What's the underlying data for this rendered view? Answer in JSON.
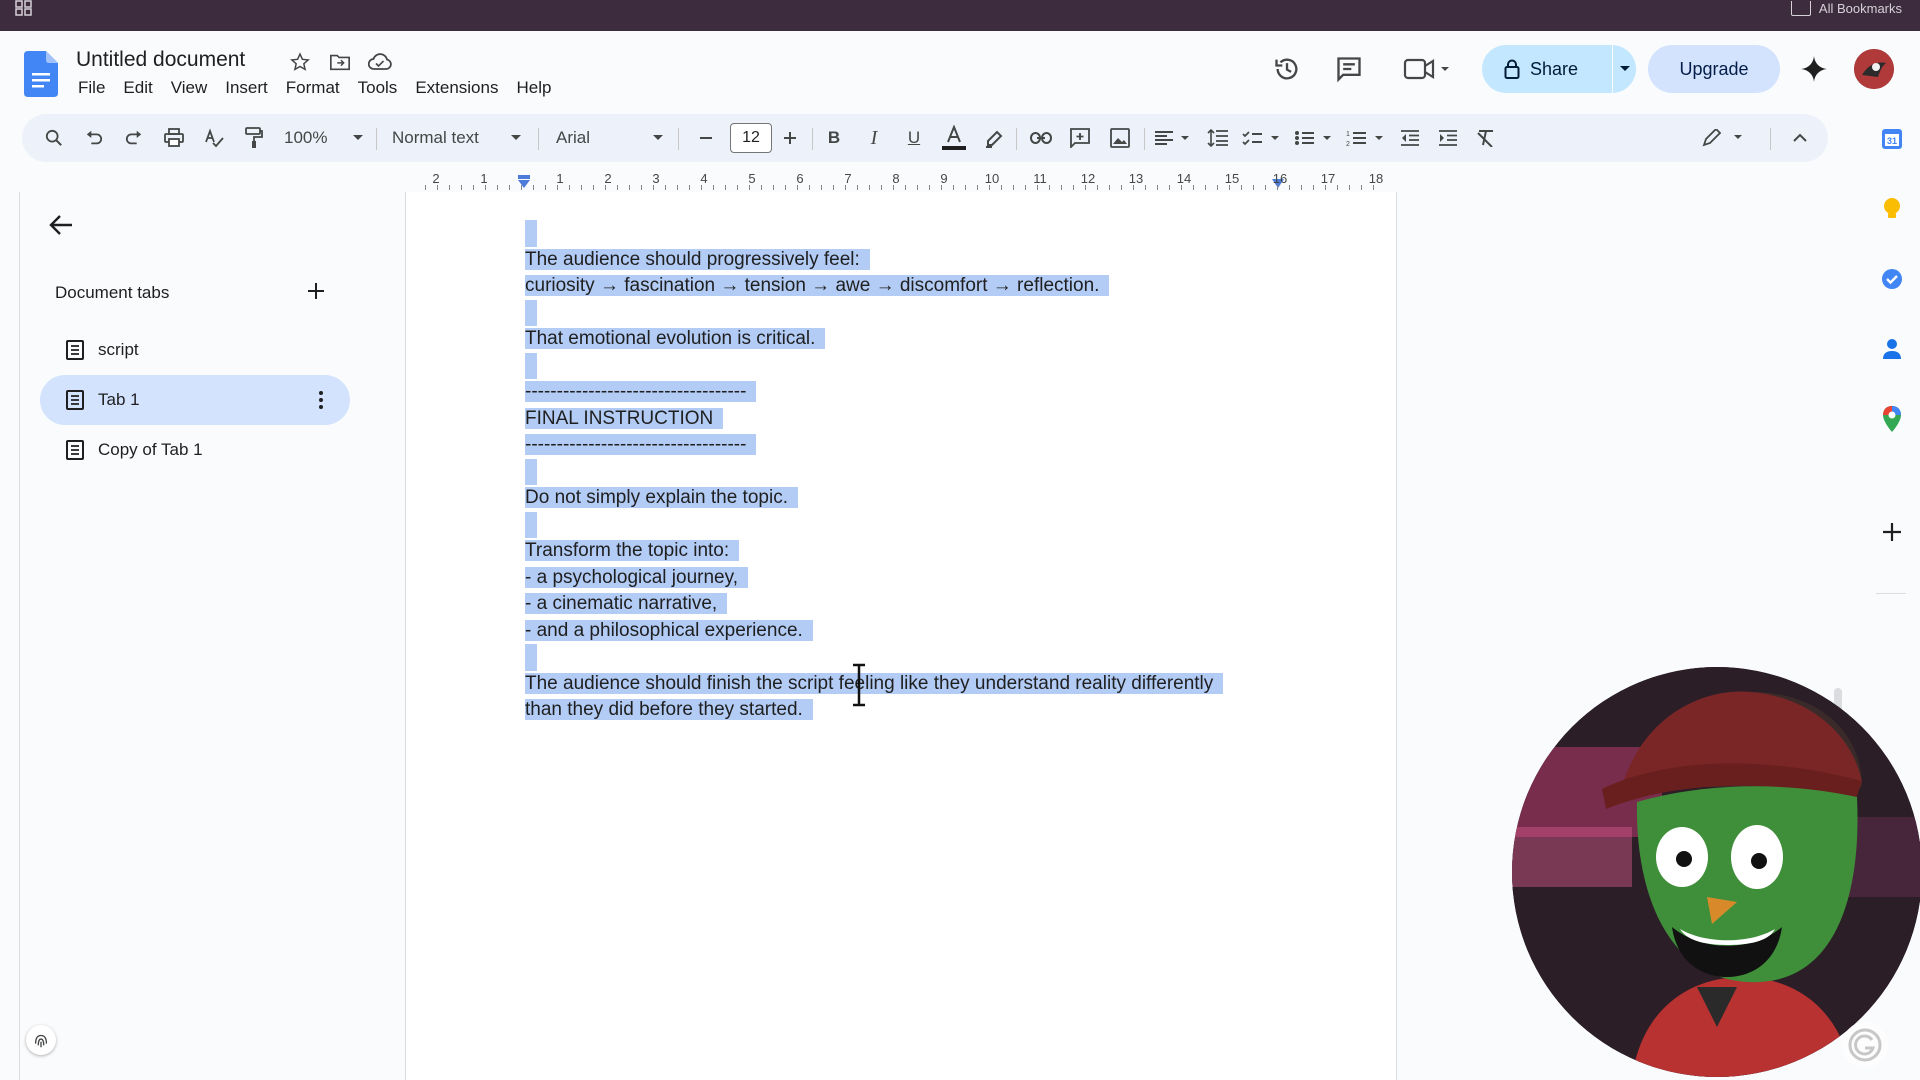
{
  "browser": {
    "bookmarks_label": "All Bookmarks"
  },
  "header": {
    "doc_title": "Untitled document",
    "menu": [
      "File",
      "Edit",
      "View",
      "Insert",
      "Format",
      "Tools",
      "Extensions",
      "Help"
    ],
    "share_label": "Share",
    "upgrade_label": "Upgrade"
  },
  "toolbar": {
    "zoom": "100%",
    "style": "Normal text",
    "font": "Arial",
    "font_size": "12"
  },
  "ruler": {
    "labels": [
      "2",
      "1",
      "1",
      "2",
      "3",
      "4",
      "5",
      "6",
      "7",
      "8",
      "9",
      "10",
      "11",
      "12",
      "13",
      "14",
      "15",
      "16",
      "17",
      "18"
    ]
  },
  "sidebar": {
    "heading": "Document tabs",
    "tabs": [
      {
        "label": "script",
        "active": false
      },
      {
        "label": "Tab 1",
        "active": true
      },
      {
        "label": "Copy of Tab 1",
        "active": false
      }
    ]
  },
  "document": {
    "lines": [
      "",
      "The audience should progressively feel:",
      "curiosity → fascination → tension → awe → discomfort → reflection.",
      "",
      "That emotional evolution is critical.",
      "",
      "-----------------------------------",
      "FINAL INSTRUCTION",
      "-----------------------------------",
      "",
      "Do not simply explain the topic.",
      "",
      "Transform the topic into:",
      "- a psychological journey,",
      "- a cinematic narrative,",
      "- and a philosophical experience.",
      "",
      "The audience should finish the script feeling like they understand reality differently",
      "than they did before they started."
    ]
  },
  "colors": {
    "selection": "#b3ccf5",
    "share_bg": "#c2e7ff",
    "upgrade_bg": "#d3e3fd",
    "active_tab": "#d3e3fd",
    "topbar": "#3d2c3e"
  }
}
